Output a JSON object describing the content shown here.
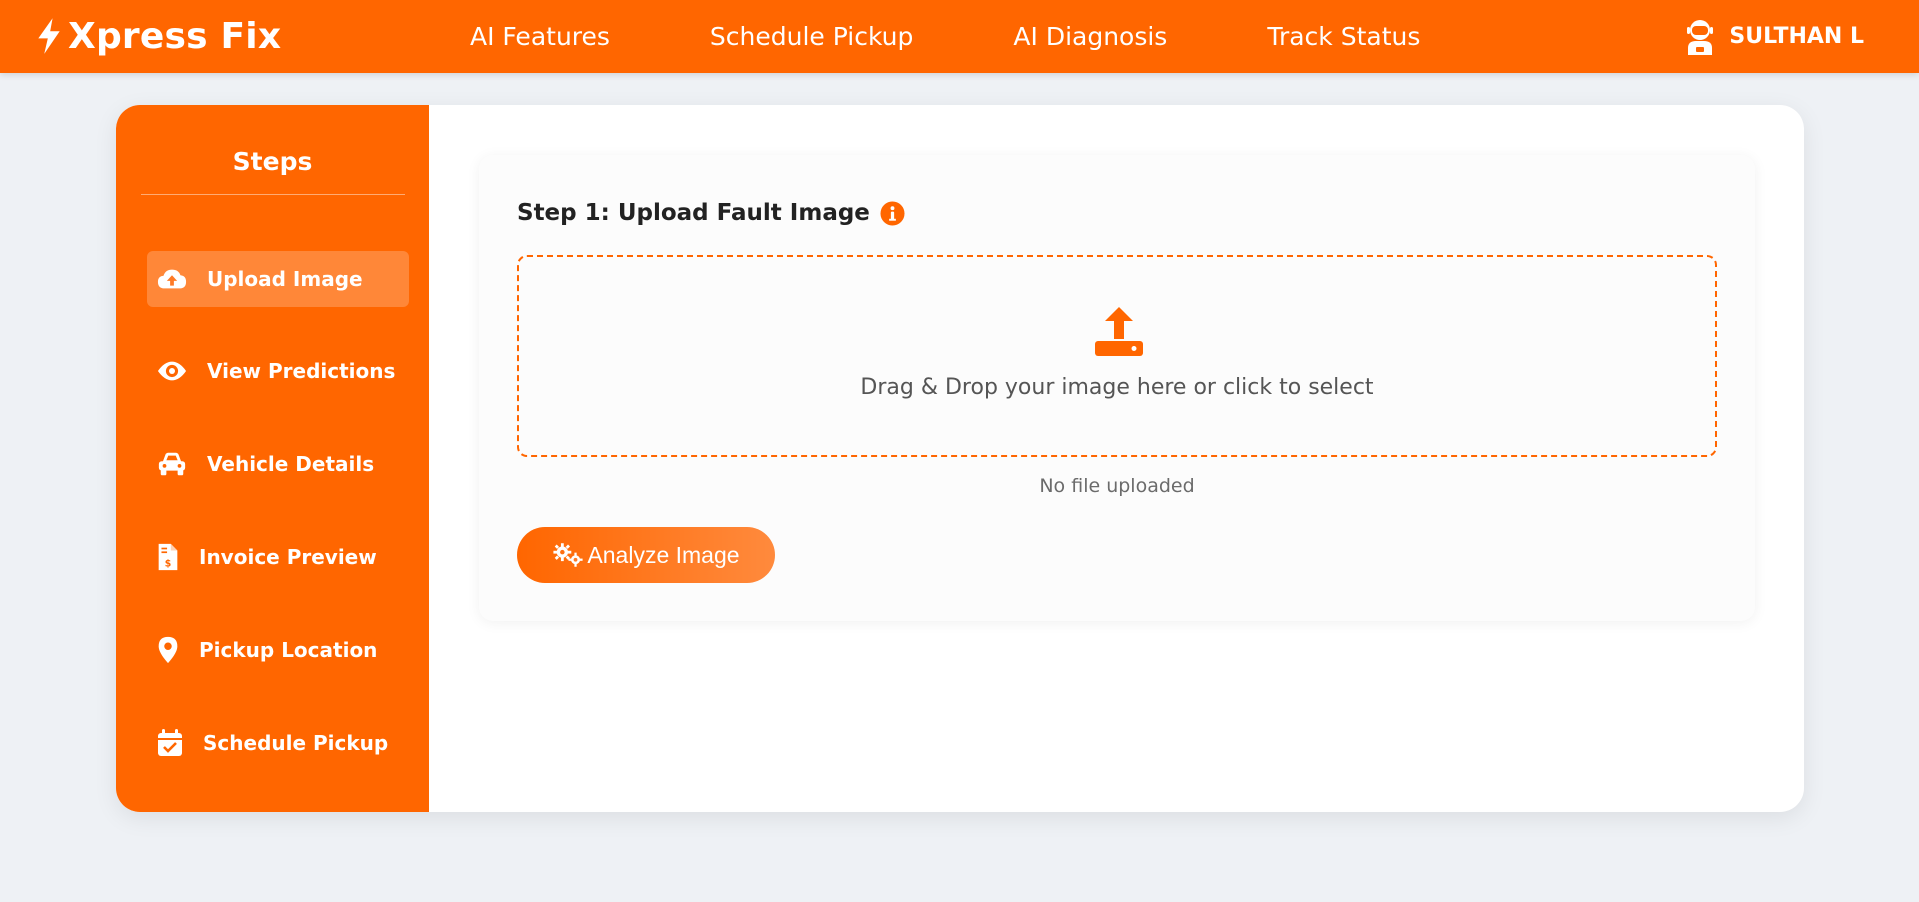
{
  "brand": {
    "name": "Xpress Fix",
    "icon": "bolt-icon"
  },
  "nav": {
    "links": [
      "AI Features",
      "Schedule Pickup",
      "AI Diagnosis",
      "Track Status"
    ]
  },
  "user": {
    "name": "SULTHAN L",
    "icon": "user-astronaut-icon"
  },
  "sidebar": {
    "title": "Steps",
    "items": [
      {
        "label": "Upload Image",
        "icon": "cloud-upload-icon",
        "active": true
      },
      {
        "label": "View Predictions",
        "icon": "eye-icon",
        "active": false
      },
      {
        "label": "Vehicle Details",
        "icon": "car-icon",
        "active": false
      },
      {
        "label": "Invoice Preview",
        "icon": "invoice-icon",
        "active": false
      },
      {
        "label": "Pickup Location",
        "icon": "location-pin-icon",
        "active": false
      },
      {
        "label": "Schedule Pickup",
        "icon": "calendar-check-icon",
        "active": false
      }
    ]
  },
  "main": {
    "step_title": "Step 1: Upload Fault Image",
    "dropzone_text": "Drag & Drop your image here or click to select",
    "file_status": "No file uploaded",
    "analyze_label": "Analyze Image"
  },
  "colors": {
    "accent": "#ff6600",
    "background": "#eef1f5",
    "card": "#ffffff"
  }
}
